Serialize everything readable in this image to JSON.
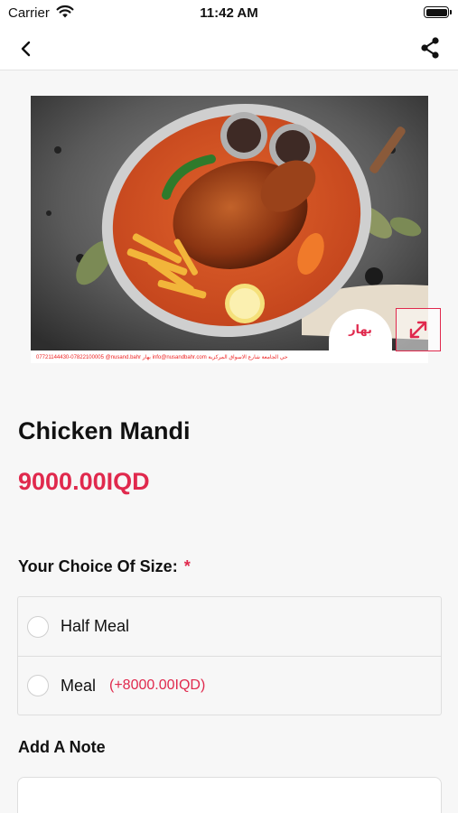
{
  "status_bar": {
    "carrier": "Carrier",
    "time": "11:42 AM"
  },
  "nav": {
    "back_icon": "chevron-left-icon",
    "share_icon": "share-icon"
  },
  "product": {
    "name": "Chicken Mandi",
    "price": "9000.00IQD",
    "image_footer_text": "07721144430-07822100005   @nusand.bahr   بهار   info@nusandbahr.com   حي الجامعة شارع الاسواق المركزية",
    "brand_text": "بهار",
    "expand_icon": "expand-arrows-icon"
  },
  "size_section": {
    "label": "Your Choice Of Size:",
    "required_mark": "*",
    "options": [
      {
        "label": "Half Meal",
        "extra": ""
      },
      {
        "label": "Meal",
        "extra": "(+8000.00IQD)"
      }
    ]
  },
  "note_section": {
    "label": "Add A Note",
    "placeholder": ""
  },
  "colors": {
    "accent": "#e0294d",
    "background": "#f7f7f7"
  }
}
